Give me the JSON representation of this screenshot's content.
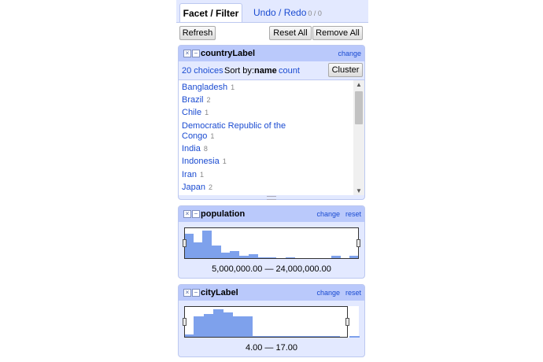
{
  "tabs": {
    "active": "Facet / Filter",
    "inactive": "Undo / Redo",
    "undo_count": "0 / 0"
  },
  "toolbar": {
    "refresh": "Refresh",
    "reset_all": "Reset All",
    "remove_all": "Remove All"
  },
  "facets": [
    {
      "title": "countryLabel",
      "change": "change",
      "choices_count": "20 choices",
      "sort_by_label": "Sort by:",
      "sort_name": "name",
      "sort_count": "count",
      "cluster": "Cluster",
      "items": [
        {
          "label": "Bangladesh",
          "count": "1"
        },
        {
          "label": "Brazil",
          "count": "2"
        },
        {
          "label": "Chile",
          "count": "1"
        },
        {
          "label": "Democratic Republic of the",
          "label2": "Congo",
          "count": "1"
        },
        {
          "label": "India",
          "count": "8"
        },
        {
          "label": "Indonesia",
          "count": "1"
        },
        {
          "label": "Iran",
          "count": "1"
        },
        {
          "label": "Japan",
          "count": "2"
        }
      ]
    },
    {
      "title": "population",
      "change": "change",
      "reset": "reset",
      "range_text": "5,000,000.00 — 24,000,000.00",
      "histogram": [
        0.85,
        0.55,
        0.95,
        0.45,
        0.2,
        0.25,
        0.1,
        0.15,
        0.05,
        0.05,
        0,
        0.05,
        0,
        0,
        0,
        0,
        0.1,
        0,
        0.1
      ],
      "selection": [
        0,
        1
      ]
    },
    {
      "title": "cityLabel",
      "change": "change",
      "reset": "reset",
      "range_text": "4.00 — 17.00",
      "histogram": [
        0.1,
        0.7,
        0.8,
        0.95,
        0.85,
        0.7,
        0.7,
        0.05,
        0.05,
        0.05,
        0.05,
        0.05,
        0.05,
        0.05,
        0.05,
        0.05,
        0,
        0.05
      ],
      "selection": [
        0,
        1
      ]
    }
  ],
  "colors": {
    "accent": "#1a4bd1",
    "header": "#bac9fb",
    "panel": "#e3e9ff",
    "bar": "#7ea1ec"
  }
}
